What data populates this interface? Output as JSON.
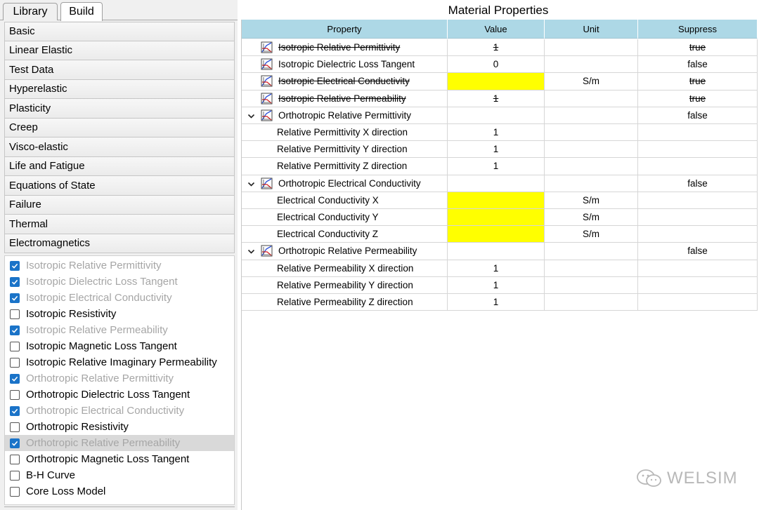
{
  "tabs": [
    "Library",
    "Build"
  ],
  "categories": [
    "Basic",
    "Linear Elastic",
    "Test Data",
    "Hyperelastic",
    "Plasticity",
    "Creep",
    "Visco-elastic",
    "Life and Fatigue",
    "Equations of State",
    "Failure",
    "Thermal",
    "Electromagnetics"
  ],
  "checklist": [
    {
      "label": "Isotropic Relative Permittivity",
      "checked": true,
      "disabled": true
    },
    {
      "label": "Isotropic Dielectric Loss Tangent",
      "checked": true,
      "disabled": true
    },
    {
      "label": "Isotropic Electrical Conductivity",
      "checked": true,
      "disabled": true
    },
    {
      "label": "Isotropic Resistivity",
      "checked": false,
      "disabled": false
    },
    {
      "label": "Isotropic Relative Permeability",
      "checked": true,
      "disabled": true
    },
    {
      "label": "Isotropic Magnetic Loss Tangent",
      "checked": false,
      "disabled": false
    },
    {
      "label": "Isotropic Relative Imaginary Permeability",
      "checked": false,
      "disabled": false
    },
    {
      "label": "Orthotropic Relative Permittivity",
      "checked": true,
      "disabled": true
    },
    {
      "label": "Orthotropic Dielectric Loss Tangent",
      "checked": false,
      "disabled": false
    },
    {
      "label": "Orthotropic Electrical Conductivity",
      "checked": true,
      "disabled": true
    },
    {
      "label": "Orthotropic Resistivity",
      "checked": false,
      "disabled": false
    },
    {
      "label": "Orthotropic Relative Permeability",
      "checked": true,
      "disabled": true,
      "selected": true
    },
    {
      "label": "Orthotropic Magnetic Loss Tangent",
      "checked": false,
      "disabled": false
    },
    {
      "label": "B-H Curve",
      "checked": false,
      "disabled": false
    },
    {
      "label": "Core Loss Model",
      "checked": false,
      "disabled": false
    }
  ],
  "panel_title": "Material Properties",
  "columns": [
    "Property",
    "Value",
    "Unit",
    "Suppress"
  ],
  "rows": [
    {
      "kind": "top",
      "property": "Isotropic Relative Permittivity",
      "value": "1",
      "unit": "",
      "suppress": "true",
      "struck": true,
      "yellow": false,
      "expand": false
    },
    {
      "kind": "top",
      "property": "Isotropic Dielectric Loss Tangent",
      "value": "0",
      "unit": "",
      "suppress": "false",
      "struck": false,
      "yellow": false,
      "expand": false
    },
    {
      "kind": "top",
      "property": "Isotropic Electrical Conductivity",
      "value": "",
      "unit": "S/m",
      "suppress": "true",
      "struck": true,
      "yellow": true,
      "expand": false
    },
    {
      "kind": "top",
      "property": "Isotropic Relative Permeability",
      "value": "1",
      "unit": "",
      "suppress": "true",
      "struck": true,
      "yellow": false,
      "expand": false
    },
    {
      "kind": "top",
      "property": "Orthotropic Relative Permittivity",
      "value": "",
      "unit": "",
      "suppress": "false",
      "struck": false,
      "yellow": false,
      "expand": true
    },
    {
      "kind": "child",
      "property": "Relative Permittivity X direction",
      "value": "1",
      "unit": "",
      "suppress": "",
      "yellow": false
    },
    {
      "kind": "child",
      "property": "Relative Permittivity Y direction",
      "value": "1",
      "unit": "",
      "suppress": "",
      "yellow": false
    },
    {
      "kind": "child",
      "property": "Relative Permittivity Z direction",
      "value": "1",
      "unit": "",
      "suppress": "",
      "yellow": false
    },
    {
      "kind": "top",
      "property": "Orthotropic Electrical Conductivity",
      "value": "",
      "unit": "",
      "suppress": "false",
      "struck": false,
      "yellow": false,
      "expand": true
    },
    {
      "kind": "child",
      "property": "Electrical Conductivity X",
      "value": "",
      "unit": "S/m",
      "suppress": "",
      "yellow": true
    },
    {
      "kind": "child",
      "property": "Electrical Conductivity Y",
      "value": "",
      "unit": "S/m",
      "suppress": "",
      "yellow": true
    },
    {
      "kind": "child",
      "property": "Electrical Conductivity Z",
      "value": "",
      "unit": "S/m",
      "suppress": "",
      "yellow": true
    },
    {
      "kind": "top",
      "property": "Orthotropic Relative Permeability",
      "value": "",
      "unit": "",
      "suppress": "false",
      "struck": false,
      "yellow": false,
      "expand": true
    },
    {
      "kind": "child",
      "property": "Relative Permeability X direction",
      "value": "1",
      "unit": "",
      "suppress": "",
      "yellow": false
    },
    {
      "kind": "child",
      "property": "Relative Permeability Y direction",
      "value": "1",
      "unit": "",
      "suppress": "",
      "yellow": false
    },
    {
      "kind": "child",
      "property": "Relative Permeability Z direction",
      "value": "1",
      "unit": "",
      "suppress": "",
      "yellow": false
    }
  ],
  "watermark": "WELSIM",
  "colors": {
    "header": "#add8e6",
    "required": "#ffff00",
    "check": "#1a73c8"
  }
}
